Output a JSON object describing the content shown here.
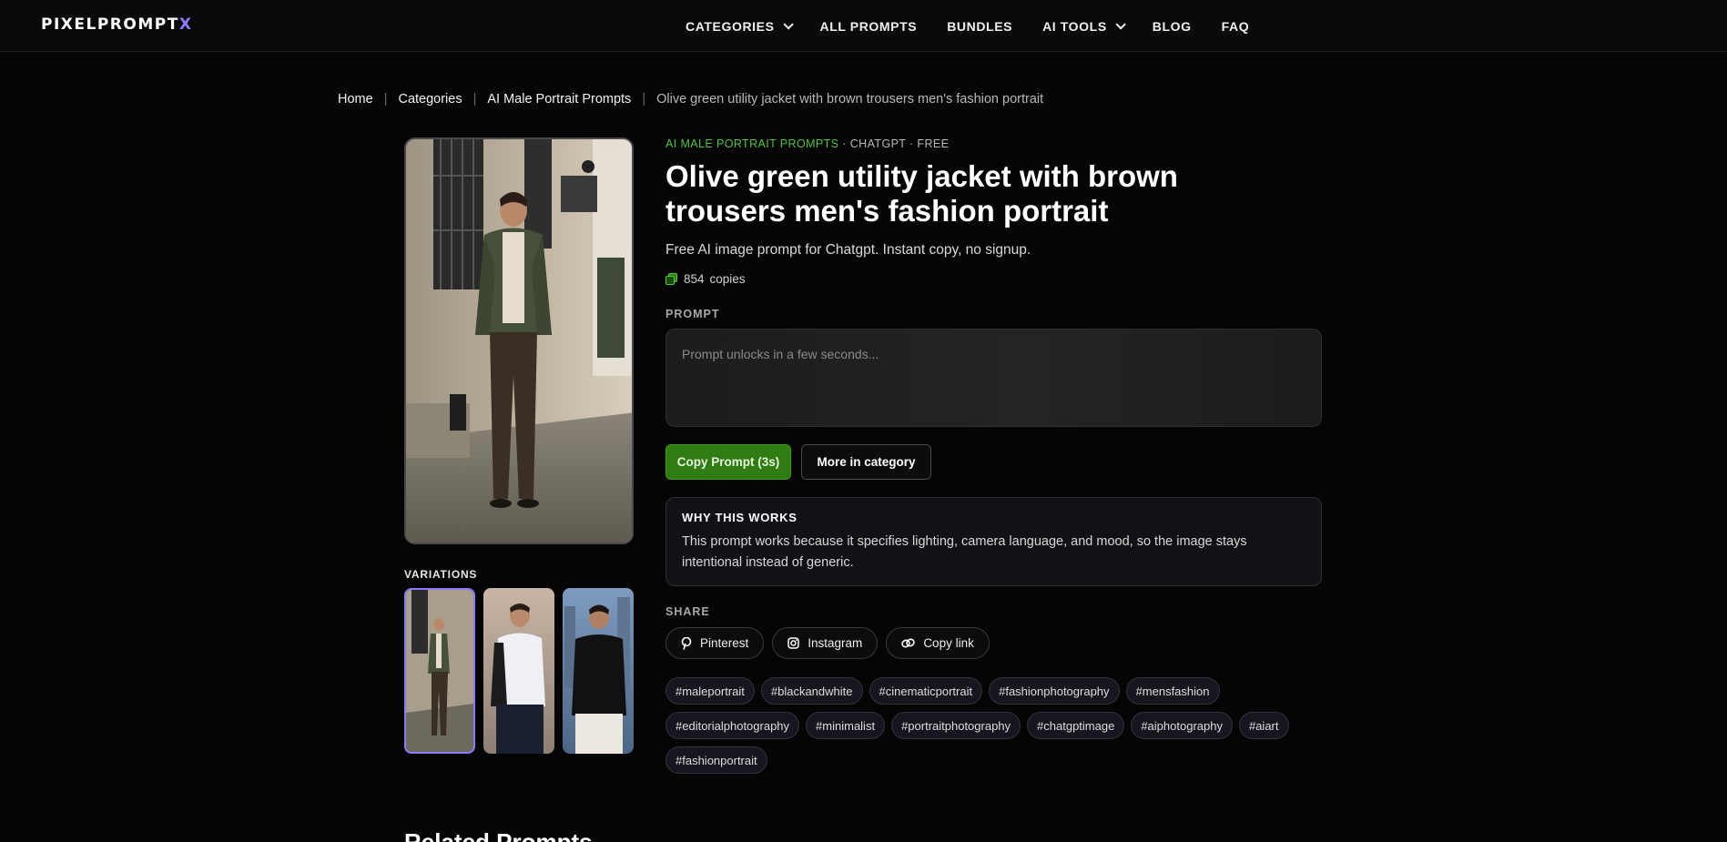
{
  "brand": {
    "logo_main": "PIXELPROMPT",
    "logo_accent": "X"
  },
  "nav": {
    "categories": "CATEGORIES",
    "all_prompts": "ALL PROMPTS",
    "bundles": "BUNDLES",
    "ai_tools": "AI TOOLS",
    "blog": "BLOG",
    "faq": "FAQ"
  },
  "breadcrumb": [
    "Home",
    "Categories",
    "AI Male Portrait Prompts",
    "Olive green utility jacket with brown trousers men's fashion portrait"
  ],
  "meta": {
    "category": "AI MALE PORTRAIT PROMPTS",
    "rest": " · CHATGPT · FREE"
  },
  "title": "Olive green utility jacket with brown trousers men's fashion portrait",
  "subtitle": "Free AI image prompt for Chatgpt. Instant copy, no signup.",
  "copies": {
    "count": "854",
    "label": "copies"
  },
  "prompt": {
    "label": "PROMPT",
    "placeholder": "Prompt unlocks in a few seconds..."
  },
  "actions": {
    "copy": "Copy Prompt (3s)",
    "more": "More in category"
  },
  "why": {
    "title": "WHY THIS WORKS",
    "text": "This prompt works because it specifies lighting, camera language, and mood, so the image stays intentional instead of generic."
  },
  "share": {
    "label": "SHARE",
    "pinterest": "Pinterest",
    "instagram": "Instagram",
    "copy_link": "Copy link"
  },
  "tags": [
    "#maleportrait",
    "#blackandwhite",
    "#cinematicportrait",
    "#fashionphotography",
    "#mensfashion",
    "#editorialphotography",
    "#minimalist",
    "#portraitphotography",
    "#chatgptimage",
    "#aiphotography",
    "#aiart",
    "#fashionportrait"
  ],
  "variations_label": "VARIATIONS",
  "related_title": "Related Prompts",
  "colors": {
    "accent_green": "#2f7d12",
    "category_green": "#4ec53a",
    "accent_purple": "#8b7bff"
  }
}
